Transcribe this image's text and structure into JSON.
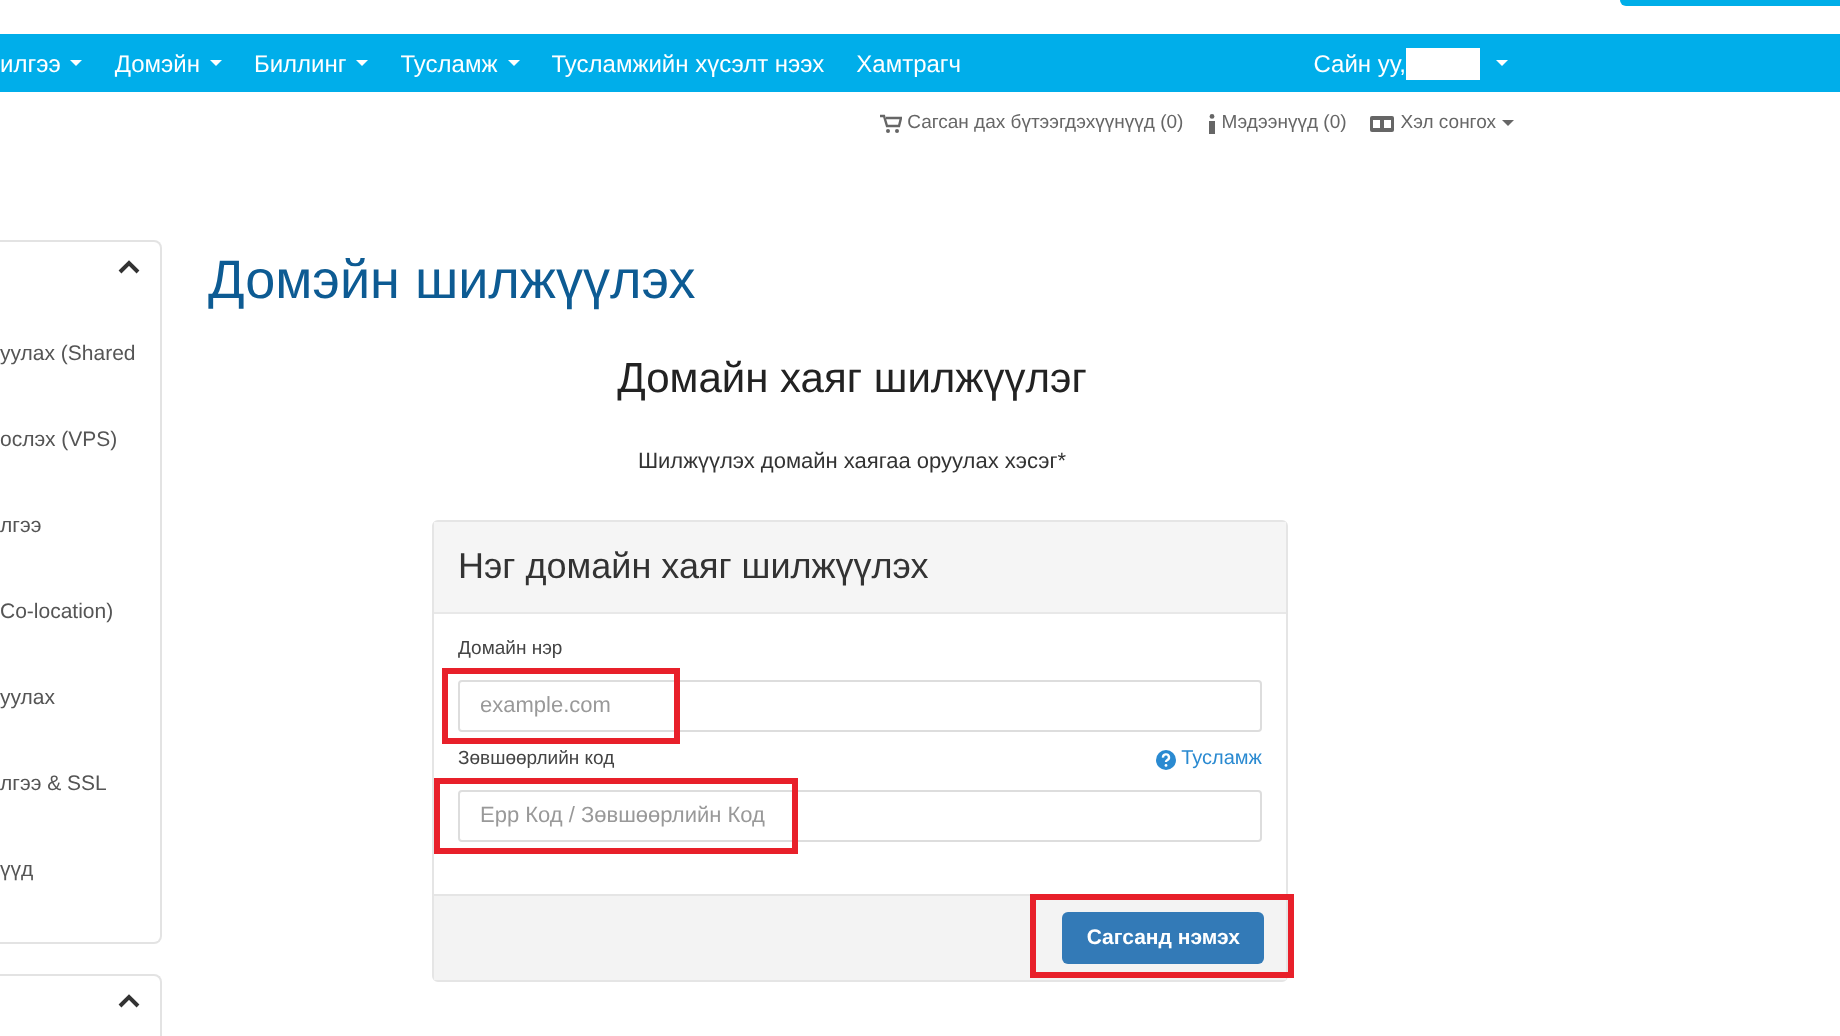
{
  "nav": {
    "items": [
      {
        "label": "илгээ",
        "dropdown": true
      },
      {
        "label": "Домэйн",
        "dropdown": true
      },
      {
        "label": "Биллинг",
        "dropdown": true
      },
      {
        "label": "Тусламж",
        "dropdown": true
      },
      {
        "label": "Тусламжийн хүсэлт нээх",
        "dropdown": false
      },
      {
        "label": "Хамтрагч",
        "dropdown": false
      }
    ],
    "greeting": "Сайн уу,"
  },
  "toolbar": [
    {
      "kind": "cart",
      "label": "Сагсан дах бүтээгдэхүүнүүд (0)"
    },
    {
      "kind": "info",
      "label": "Мэдээнүүд (0)"
    },
    {
      "kind": "language",
      "label": "Хэл сонгох"
    }
  ],
  "sidebar": {
    "expanded": true,
    "items": [
      "уулах (Shared",
      "ослэх (VPS)",
      "лгээ",
      "Co-location)",
      "уулах",
      "лгээ & SSL",
      "үүд"
    ]
  },
  "page_title": "Домэйн шилжүүлэх",
  "heading": "Домайн хаяг шилжүүлэг",
  "subheading": "Шилжүүлэх домайн хаягаа оруулах хэсэг*",
  "form": {
    "title": "Нэг домайн хаяг шилжүүлэх",
    "fields": [
      {
        "label": "Домайн нэр",
        "placeholder": "example.com",
        "highlighted": true
      },
      {
        "label": "Зөвшөөрлийн код",
        "placeholder": "Ерр Код / Зөвшөөрлийн Код",
        "help": "Тусламж",
        "highlighted": true
      }
    ],
    "submit": {
      "label": "Сагсанд нэмэх",
      "highlighted": true
    }
  }
}
